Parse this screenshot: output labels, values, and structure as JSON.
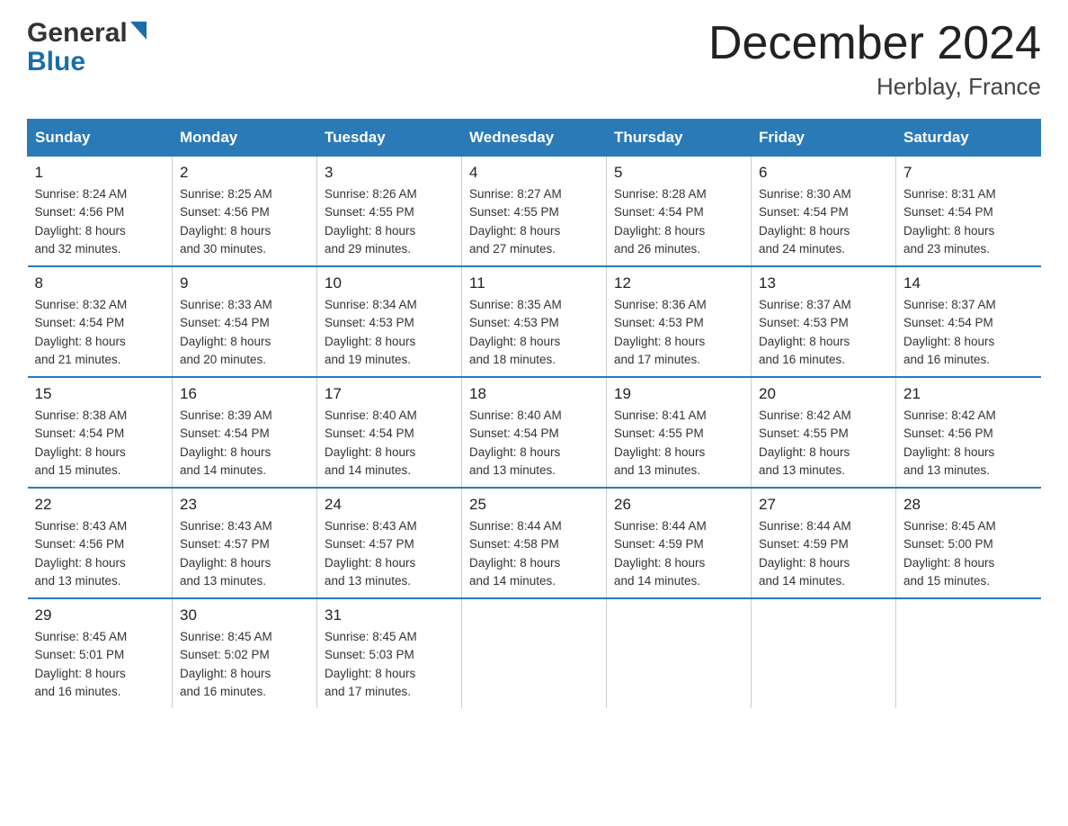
{
  "header": {
    "logo_general": "General",
    "logo_blue": "Blue",
    "month_title": "December 2024",
    "location": "Herblay, France"
  },
  "weekdays": [
    "Sunday",
    "Monday",
    "Tuesday",
    "Wednesday",
    "Thursday",
    "Friday",
    "Saturday"
  ],
  "weeks": [
    [
      {
        "day": "1",
        "sunrise": "8:24 AM",
        "sunset": "4:56 PM",
        "daylight": "8 hours and 32 minutes."
      },
      {
        "day": "2",
        "sunrise": "8:25 AM",
        "sunset": "4:56 PM",
        "daylight": "8 hours and 30 minutes."
      },
      {
        "day": "3",
        "sunrise": "8:26 AM",
        "sunset": "4:55 PM",
        "daylight": "8 hours and 29 minutes."
      },
      {
        "day": "4",
        "sunrise": "8:27 AM",
        "sunset": "4:55 PM",
        "daylight": "8 hours and 27 minutes."
      },
      {
        "day": "5",
        "sunrise": "8:28 AM",
        "sunset": "4:54 PM",
        "daylight": "8 hours and 26 minutes."
      },
      {
        "day": "6",
        "sunrise": "8:30 AM",
        "sunset": "4:54 PM",
        "daylight": "8 hours and 24 minutes."
      },
      {
        "day": "7",
        "sunrise": "8:31 AM",
        "sunset": "4:54 PM",
        "daylight": "8 hours and 23 minutes."
      }
    ],
    [
      {
        "day": "8",
        "sunrise": "8:32 AM",
        "sunset": "4:54 PM",
        "daylight": "8 hours and 21 minutes."
      },
      {
        "day": "9",
        "sunrise": "8:33 AM",
        "sunset": "4:54 PM",
        "daylight": "8 hours and 20 minutes."
      },
      {
        "day": "10",
        "sunrise": "8:34 AM",
        "sunset": "4:53 PM",
        "daylight": "8 hours and 19 minutes."
      },
      {
        "day": "11",
        "sunrise": "8:35 AM",
        "sunset": "4:53 PM",
        "daylight": "8 hours and 18 minutes."
      },
      {
        "day": "12",
        "sunrise": "8:36 AM",
        "sunset": "4:53 PM",
        "daylight": "8 hours and 17 minutes."
      },
      {
        "day": "13",
        "sunrise": "8:37 AM",
        "sunset": "4:53 PM",
        "daylight": "8 hours and 16 minutes."
      },
      {
        "day": "14",
        "sunrise": "8:37 AM",
        "sunset": "4:54 PM",
        "daylight": "8 hours and 16 minutes."
      }
    ],
    [
      {
        "day": "15",
        "sunrise": "8:38 AM",
        "sunset": "4:54 PM",
        "daylight": "8 hours and 15 minutes."
      },
      {
        "day": "16",
        "sunrise": "8:39 AM",
        "sunset": "4:54 PM",
        "daylight": "8 hours and 14 minutes."
      },
      {
        "day": "17",
        "sunrise": "8:40 AM",
        "sunset": "4:54 PM",
        "daylight": "8 hours and 14 minutes."
      },
      {
        "day": "18",
        "sunrise": "8:40 AM",
        "sunset": "4:54 PM",
        "daylight": "8 hours and 13 minutes."
      },
      {
        "day": "19",
        "sunrise": "8:41 AM",
        "sunset": "4:55 PM",
        "daylight": "8 hours and 13 minutes."
      },
      {
        "day": "20",
        "sunrise": "8:42 AM",
        "sunset": "4:55 PM",
        "daylight": "8 hours and 13 minutes."
      },
      {
        "day": "21",
        "sunrise": "8:42 AM",
        "sunset": "4:56 PM",
        "daylight": "8 hours and 13 minutes."
      }
    ],
    [
      {
        "day": "22",
        "sunrise": "8:43 AM",
        "sunset": "4:56 PM",
        "daylight": "8 hours and 13 minutes."
      },
      {
        "day": "23",
        "sunrise": "8:43 AM",
        "sunset": "4:57 PM",
        "daylight": "8 hours and 13 minutes."
      },
      {
        "day": "24",
        "sunrise": "8:43 AM",
        "sunset": "4:57 PM",
        "daylight": "8 hours and 13 minutes."
      },
      {
        "day": "25",
        "sunrise": "8:44 AM",
        "sunset": "4:58 PM",
        "daylight": "8 hours and 14 minutes."
      },
      {
        "day": "26",
        "sunrise": "8:44 AM",
        "sunset": "4:59 PM",
        "daylight": "8 hours and 14 minutes."
      },
      {
        "day": "27",
        "sunrise": "8:44 AM",
        "sunset": "4:59 PM",
        "daylight": "8 hours and 14 minutes."
      },
      {
        "day": "28",
        "sunrise": "8:45 AM",
        "sunset": "5:00 PM",
        "daylight": "8 hours and 15 minutes."
      }
    ],
    [
      {
        "day": "29",
        "sunrise": "8:45 AM",
        "sunset": "5:01 PM",
        "daylight": "8 hours and 16 minutes."
      },
      {
        "day": "30",
        "sunrise": "8:45 AM",
        "sunset": "5:02 PM",
        "daylight": "8 hours and 16 minutes."
      },
      {
        "day": "31",
        "sunrise": "8:45 AM",
        "sunset": "5:03 PM",
        "daylight": "8 hours and 17 minutes."
      },
      null,
      null,
      null,
      null
    ]
  ],
  "labels": {
    "sunrise": "Sunrise:",
    "sunset": "Sunset:",
    "daylight": "Daylight:"
  }
}
